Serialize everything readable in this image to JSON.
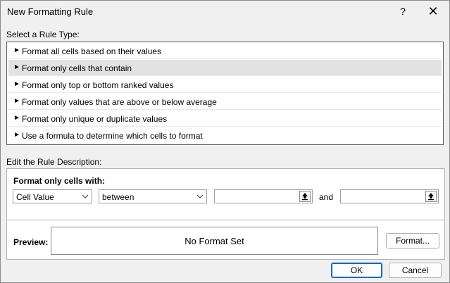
{
  "dialog": {
    "title": "New Formatting Rule",
    "help_label": "?",
    "close_label": "✕"
  },
  "rule_type": {
    "label": "Select a Rule Type:",
    "items": [
      {
        "label": "Format all cells based on their values"
      },
      {
        "label": "Format only cells that contain"
      },
      {
        "label": "Format only top or bottom ranked values"
      },
      {
        "label": "Format only values that are above or below average"
      },
      {
        "label": "Format only unique or duplicate values"
      },
      {
        "label": "Use a formula to determine which cells to format"
      }
    ],
    "selected_index": 1,
    "arrow_glyph": "►"
  },
  "description": {
    "label": "Edit the Rule Description:",
    "format_with_label": "Format only cells with:",
    "condition_type": "Cell Value",
    "operator": "between",
    "value1": "",
    "value2": "",
    "and_label": "and",
    "preview_label": "Preview:",
    "preview_text": "No Format Set",
    "format_button": "Format..."
  },
  "buttons": {
    "ok": "OK",
    "cancel": "Cancel"
  },
  "colors": {
    "accent": "#0067c0",
    "selection": "#e2e2e2"
  }
}
